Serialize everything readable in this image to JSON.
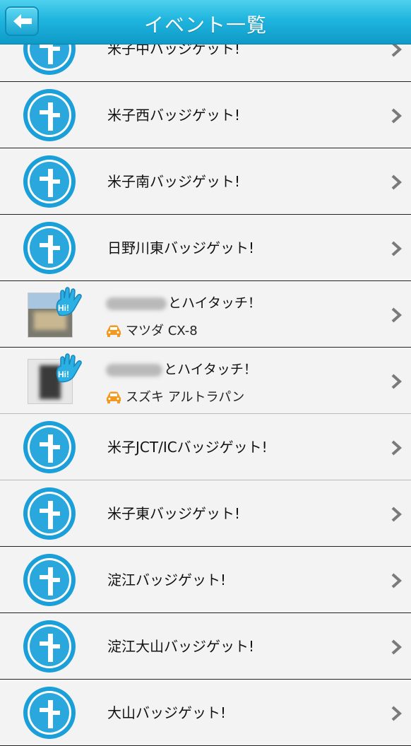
{
  "header": {
    "title": "イベント一覧",
    "back_icon": "back-arrow-icon"
  },
  "colors": {
    "header_top": "#4fd0ee",
    "header_bottom": "#0e9ac7",
    "badge_blue": "#1b9fd9",
    "car_orange": "#f39a1e"
  },
  "items": [
    {
      "type": "badge",
      "label": "米子中バッジゲット!"
    },
    {
      "type": "badge",
      "label": "米子西バッジゲット!"
    },
    {
      "type": "badge",
      "label": "米子南バッジゲット!"
    },
    {
      "type": "badge",
      "label": "日野川東バッジゲット!"
    },
    {
      "type": "hitouch",
      "label": "とハイタッチ！",
      "car": "マツダ CX-8"
    },
    {
      "type": "hitouch",
      "label": "とハイタッチ！",
      "car": "スズキ アルトラパン"
    },
    {
      "type": "badge",
      "label": "米子JCT/ICバッジゲット!"
    },
    {
      "type": "badge",
      "label": "米子東バッジゲット!"
    },
    {
      "type": "badge",
      "label": "淀江バッジゲット!"
    },
    {
      "type": "badge",
      "label": "淀江大山バッジゲット!"
    },
    {
      "type": "badge",
      "label": "大山バッジゲット!"
    }
  ]
}
